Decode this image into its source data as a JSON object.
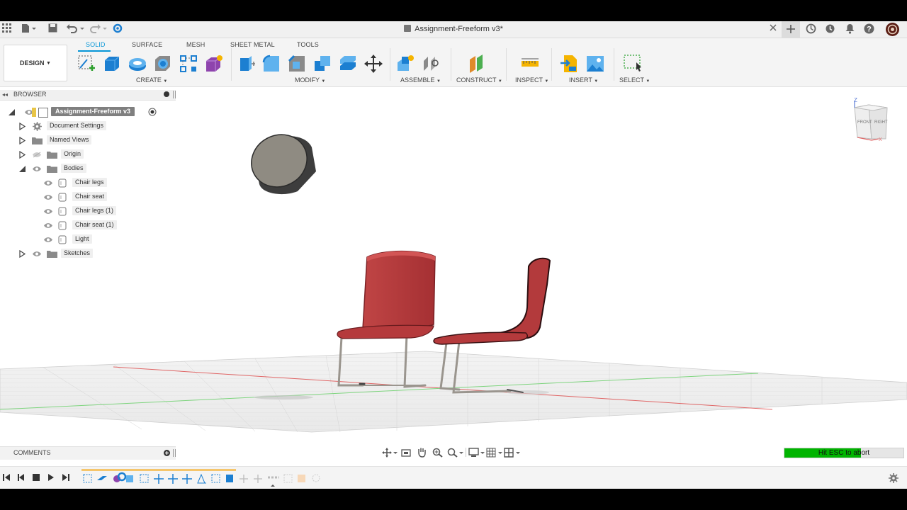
{
  "window": {
    "title": "Assignment-Freeform v3*"
  },
  "toolbar_icons": [
    "apps-grid-icon",
    "file-icon",
    "save-icon",
    "undo-icon",
    "redo-icon",
    "refresh-icon",
    "close-icon",
    "new-tab-icon",
    "extensions-icon",
    "history-icon",
    "notifications-icon",
    "help-icon",
    "avatar"
  ],
  "ribbon": {
    "workspace_button": "DESIGN",
    "tabs": [
      "SOLID",
      "SURFACE",
      "MESH",
      "SHEET METAL",
      "TOOLS"
    ],
    "active_tab": "SOLID",
    "groups": [
      "CREATE",
      "MODIFY",
      "ASSEMBLE",
      "CONSTRUCT",
      "INSPECT",
      "INSERT",
      "SELECT"
    ]
  },
  "browser": {
    "title": "BROWSER",
    "root": "Assignment-Freeform v3",
    "items": [
      {
        "label": "Document Settings",
        "expanded": false
      },
      {
        "label": "Named Views",
        "expanded": false
      },
      {
        "label": "Origin",
        "expanded": false
      },
      {
        "label": "Bodies",
        "expanded": true
      },
      {
        "label": "Sketches",
        "expanded": false
      }
    ],
    "bodies": [
      "Chair legs",
      "Chair seat",
      "Chair legs (1)",
      "Chair seat (1)",
      "Light"
    ]
  },
  "comments": {
    "title": "COMMENTS"
  },
  "status": {
    "text": "Hit ESC to abort",
    "progress": 0.64
  },
  "viewcube": {
    "front": "FRONT",
    "right": "RIGHT",
    "axis_z": "Z",
    "axis_x": "X"
  },
  "colors": {
    "accent": "#0696d7",
    "chair_red": "#b0393b",
    "progress_green": "#00b400"
  }
}
